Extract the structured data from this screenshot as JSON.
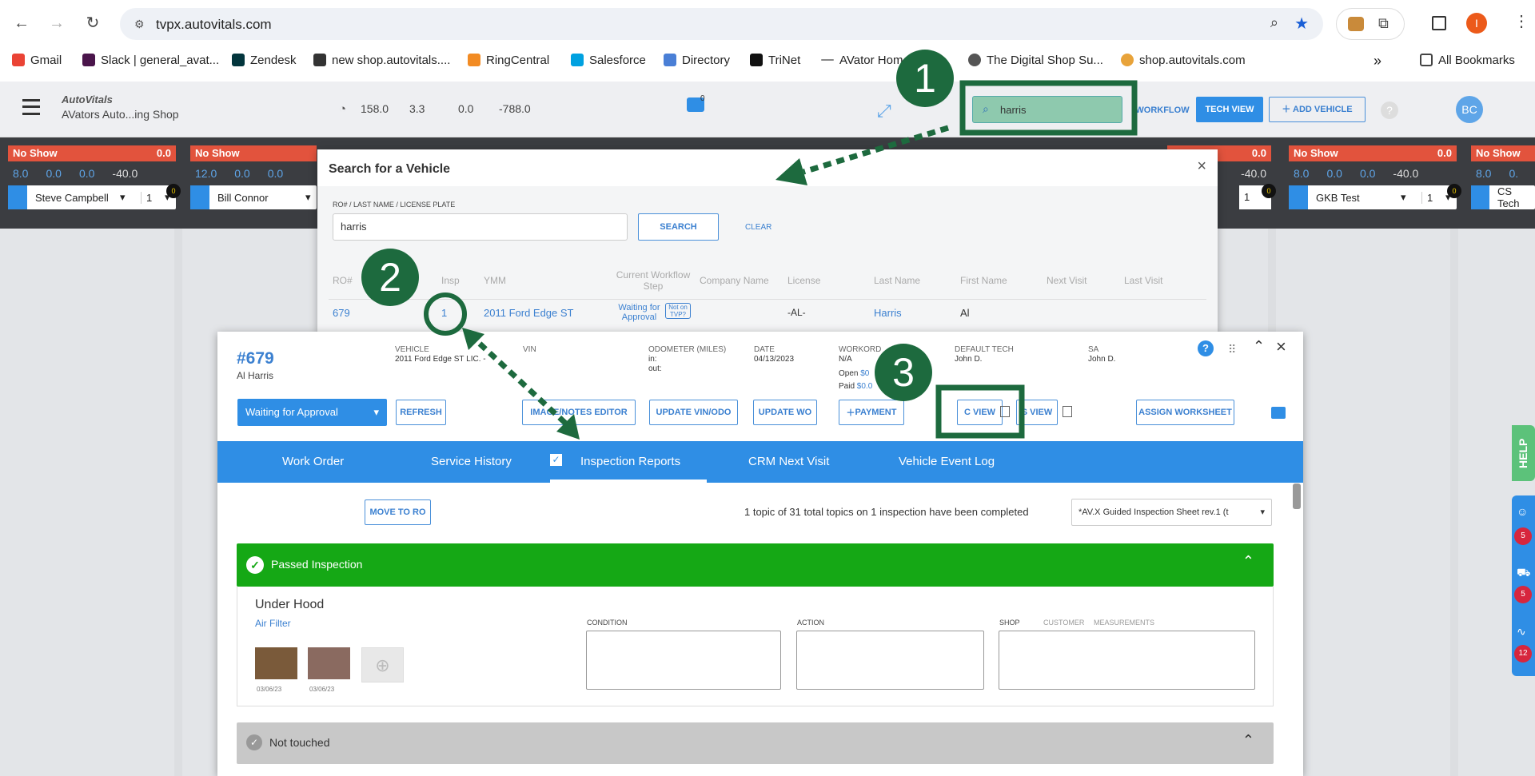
{
  "browser": {
    "url": "tvpx.autovitals.com",
    "bookmarks": [
      "Gmail",
      "Slack | general_avat...",
      "Zendesk",
      "new shop.autovitals....",
      "RingCentral",
      "Salesforce",
      "Directory",
      "TriNet",
      "AVator Hom",
      "The Digital Shop Su...",
      "shop.autovitals.com"
    ],
    "all_bookmarks": "All Bookmarks",
    "profile_initial": "I"
  },
  "app": {
    "logo": "AutoVitals",
    "shop": "AVators Auto...ing Shop",
    "stats": [
      "158.0",
      "3.3",
      "0.0",
      "-788.0"
    ],
    "chat_count": "0",
    "search_value": "harris",
    "workflow": "WORKFLOW",
    "tech_view": "TECH VIEW",
    "add_vehicle": "ADD VEHICLE",
    "user": "BC"
  },
  "techs": [
    {
      "status": "No Show",
      "score": "0.0",
      "nums": [
        "8.0",
        "0.0",
        "0.0",
        "-40.0"
      ],
      "badge": "0",
      "name": "Steve Campbell",
      "count": "1"
    },
    {
      "status": "No Show",
      "score": "",
      "nums": [
        "12.0",
        "0.0",
        "0.0"
      ],
      "badge": "",
      "name": "Bill Connor",
      "count": ""
    },
    {
      "status": "",
      "score": "0.0",
      "nums": [
        "",
        "",
        "",
        "-40.0"
      ],
      "badge": "0",
      "name": "",
      "count": "1"
    },
    {
      "status": "No Show",
      "score": "0.0",
      "nums": [
        "8.0",
        "0.0",
        "0.0",
        "-40.0"
      ],
      "badge": "0",
      "name": "GKB Test",
      "count": "1"
    },
    {
      "status": "No Show",
      "score": "",
      "nums": [
        "8.0",
        "0."
      ],
      "badge": "",
      "name": "CS Tech",
      "count": ""
    }
  ],
  "search": {
    "title": "Search for a Vehicle",
    "field_label": "RO# / LAST NAME / LICENSE PLATE",
    "value": "harris",
    "search_btn": "SEARCH",
    "clear": "CLEAR",
    "columns": [
      "RO#",
      "Insp",
      "YMM",
      "Current Workflow Step",
      "Company Name",
      "License",
      "Last Name",
      "First Name",
      "Next Visit",
      "Last Visit"
    ],
    "row": {
      "ro": "679",
      "insp": "1",
      "ymm": "2011 Ford Edge ST",
      "step": "Waiting for Approval",
      "tvp": "Not on TVP?",
      "license": "-AL-",
      "last": "Harris",
      "first": "Al"
    }
  },
  "wo": {
    "number": "#679",
    "customer": "Al Harris",
    "vehicle_label": "VEHICLE",
    "vehicle": "2011 Ford Edge ST LIC. -",
    "vin_label": "VIN",
    "odo_label": "ODOMETER (MILES)",
    "odo_in": "in:",
    "odo_out": "out:",
    "date_label": "DATE",
    "date": "04/13/2023",
    "workorder_label": "WORKORD",
    "workorder": "N/A",
    "open": "Open",
    "open_val": "$0",
    "paid": "Paid",
    "paid_val": "$0.0",
    "tech_label": "DEFAULT TECH",
    "tech": "John D.",
    "sa_label": "SA",
    "sa": "John D.",
    "status": "Waiting for Approval",
    "buttons": [
      "REFRESH",
      "IMAGE/NOTES EDITOR",
      "UPDATE VIN/ODO",
      "UPDATE WO",
      "PAYMENT",
      "C VIEW",
      "S VIEW",
      "ASSIGN WORKSHEET"
    ],
    "tabs": [
      "Work Order",
      "Service History",
      "Inspection Reports",
      "CRM Next Visit",
      "Vehicle Event Log"
    ],
    "move_to_ro": "MOVE TO RO",
    "summary": "1 topic of 31 total topics on 1 inspection have been completed",
    "sheet": "*AV.X Guided Inspection Sheet rev.1 (t",
    "passed": "Passed Inspection",
    "section": "Under Hood",
    "item": "Air Filter",
    "dates": [
      "03/06/23",
      "03/06/23"
    ],
    "fields": [
      "CONDITION",
      "ACTION",
      "SHOP",
      "CUSTOMER",
      "MEASUREMENTS"
    ],
    "not_touched": "Not touched"
  },
  "side": {
    "help": "HELP",
    "counts": [
      "5",
      "5",
      "12"
    ]
  },
  "steps": [
    "1",
    "2",
    "3"
  ],
  "colors": {
    "accent": "#2f8ee5",
    "green": "#1d6a3e",
    "passed": "#15a815",
    "noshow": "#e2533d"
  }
}
